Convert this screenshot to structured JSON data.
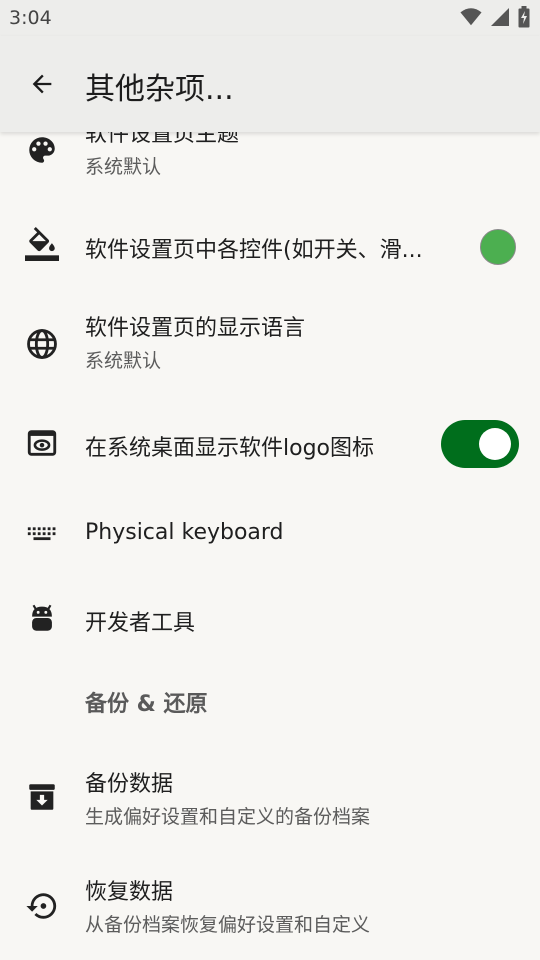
{
  "status_bar": {
    "time": "3:04"
  },
  "app_bar": {
    "title": "其他杂项..."
  },
  "items": [
    {
      "title": "软件设置页主题",
      "subtitle": "系统默认",
      "icon": "palette-icon"
    },
    {
      "title": "软件设置页中各控件(如开关、滑...",
      "icon": "format-color-fill-icon",
      "color": "#4caf50"
    },
    {
      "title": "软件设置页的显示语言",
      "subtitle": "系统默认",
      "icon": "globe-icon"
    },
    {
      "title": "在系统桌面显示软件logo图标",
      "icon": "app-preview-icon",
      "toggle_on": true
    },
    {
      "title": "Physical keyboard",
      "icon": "keyboard-icon"
    },
    {
      "title": "开发者工具",
      "icon": "android-icon"
    }
  ],
  "section": {
    "header": "备份 & 还原",
    "items": [
      {
        "title": "备份数据",
        "subtitle": "生成偏好设置和自定义的备份档案",
        "icon": "archive-icon"
      },
      {
        "title": "恢复数据",
        "subtitle": "从备份档案恢复偏好设置和自定义",
        "icon": "restore-icon"
      }
    ]
  },
  "colors": {
    "accent_dot": "#4caf50",
    "toggle_track": "#006e1c"
  }
}
